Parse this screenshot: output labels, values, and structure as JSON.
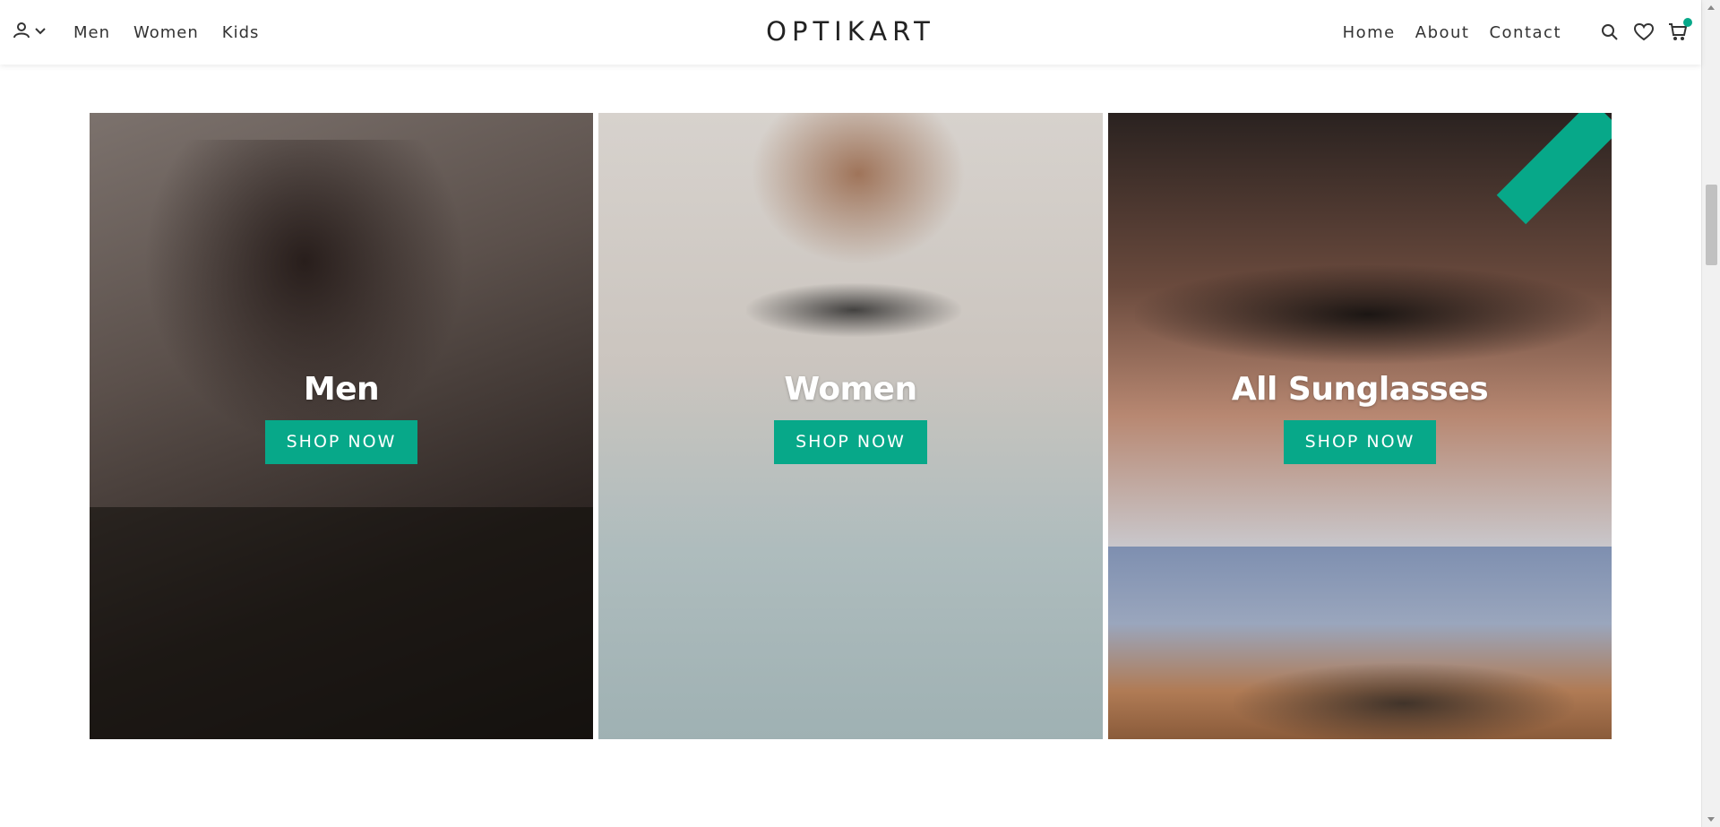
{
  "brand": {
    "logo": "OPTIKART",
    "accent": "#07a889"
  },
  "header": {
    "left_nav": [
      {
        "label": "Men"
      },
      {
        "label": "Women"
      },
      {
        "label": "Kids"
      }
    ],
    "right_nav": [
      {
        "label": "Home"
      },
      {
        "label": "About"
      },
      {
        "label": "Contact"
      }
    ],
    "icons": [
      "account-icon",
      "chevron-down-icon",
      "search-icon",
      "heart-icon",
      "cart-icon"
    ]
  },
  "categories": [
    {
      "title": "Men",
      "button": "SHOP NOW"
    },
    {
      "title": "Women",
      "button": "SHOP NOW"
    },
    {
      "title": "All Sunglasses",
      "button": "SHOP NOW"
    }
  ]
}
